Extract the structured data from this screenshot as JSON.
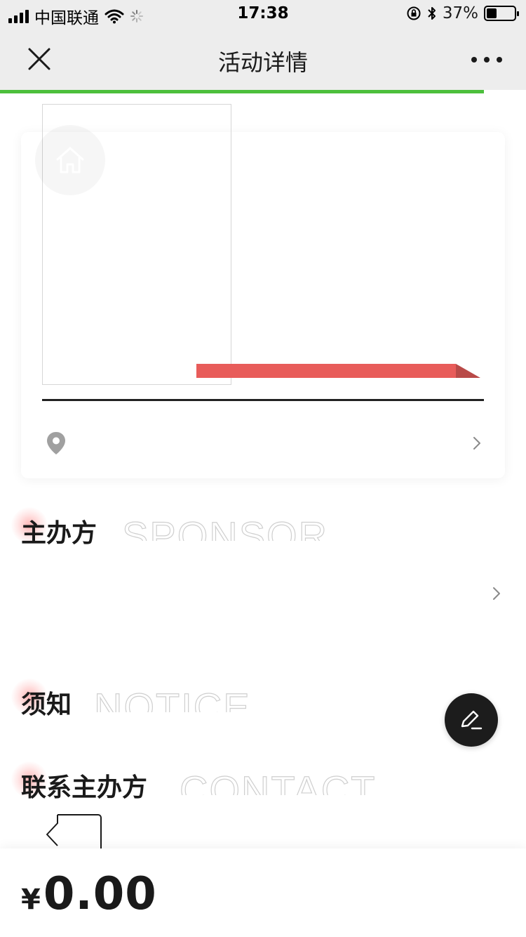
{
  "status_bar": {
    "carrier": "中国联通",
    "time": "17:38",
    "battery": "37%",
    "battery_level": 0.37
  },
  "nav": {
    "title": "活动详情",
    "load_progress": 0.92
  },
  "sections": {
    "sponsor": {
      "title": "主办方",
      "en": "SPONSOR"
    },
    "notice": {
      "title": "须知",
      "en": "NOTICE"
    },
    "contact": {
      "title": "联系主办方",
      "en": "CONTACT"
    }
  },
  "footer": {
    "currency": "¥",
    "price": "0.00"
  },
  "colors": {
    "accent_green": "#4cbf3c",
    "ribbon_red": "#e85c5a",
    "ribbon_dark": "#b94a48"
  },
  "icons": {
    "close": "close-icon",
    "more": "more-icon",
    "home": "home-icon",
    "location": "location-pin-icon",
    "edit": "edit-icon"
  }
}
